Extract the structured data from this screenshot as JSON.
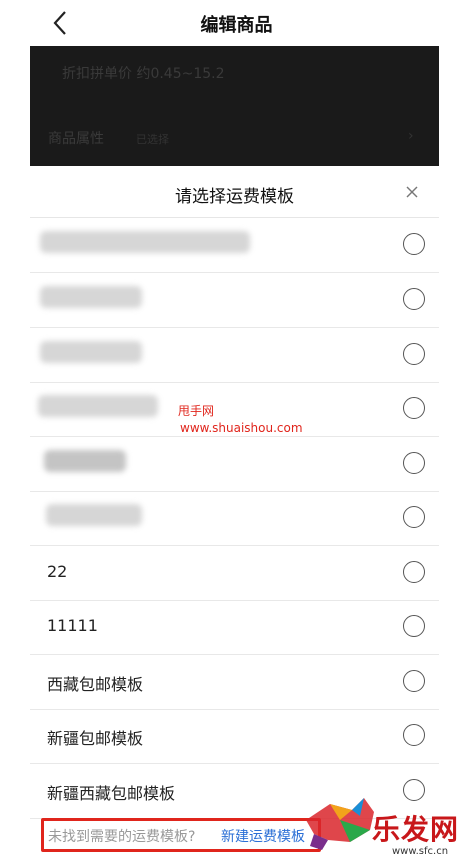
{
  "header": {
    "title": "编辑商品"
  },
  "background": {
    "row1_text": "折扣拼单价 约0.45~15.2",
    "row2_label": "商品属性",
    "row2_value": "已选择",
    "row2_chevron": "›"
  },
  "sheet": {
    "title": "请选择运费模板",
    "close_glyph": "×",
    "options": [
      {
        "label": ""
      },
      {
        "label": ""
      },
      {
        "label": ""
      },
      {
        "label": ""
      },
      {
        "label": ""
      },
      {
        "label": ""
      },
      {
        "label": "22"
      },
      {
        "label": "11111"
      },
      {
        "label": "西藏包邮模板"
      },
      {
        "label": "新疆包邮模板"
      },
      {
        "label": "新疆西藏包邮模板"
      }
    ],
    "footer_prompt": "未找到需要的运费模板?",
    "footer_link": "新建运费模板"
  },
  "watermark": {
    "name": "甩手网",
    "url": "www.shuaishou.com"
  },
  "logo": {
    "text": "乐发网",
    "url": "www.sfc.cn"
  },
  "colors": {
    "accent_red": "#e0251c",
    "link_blue": "#2b6fd6"
  }
}
